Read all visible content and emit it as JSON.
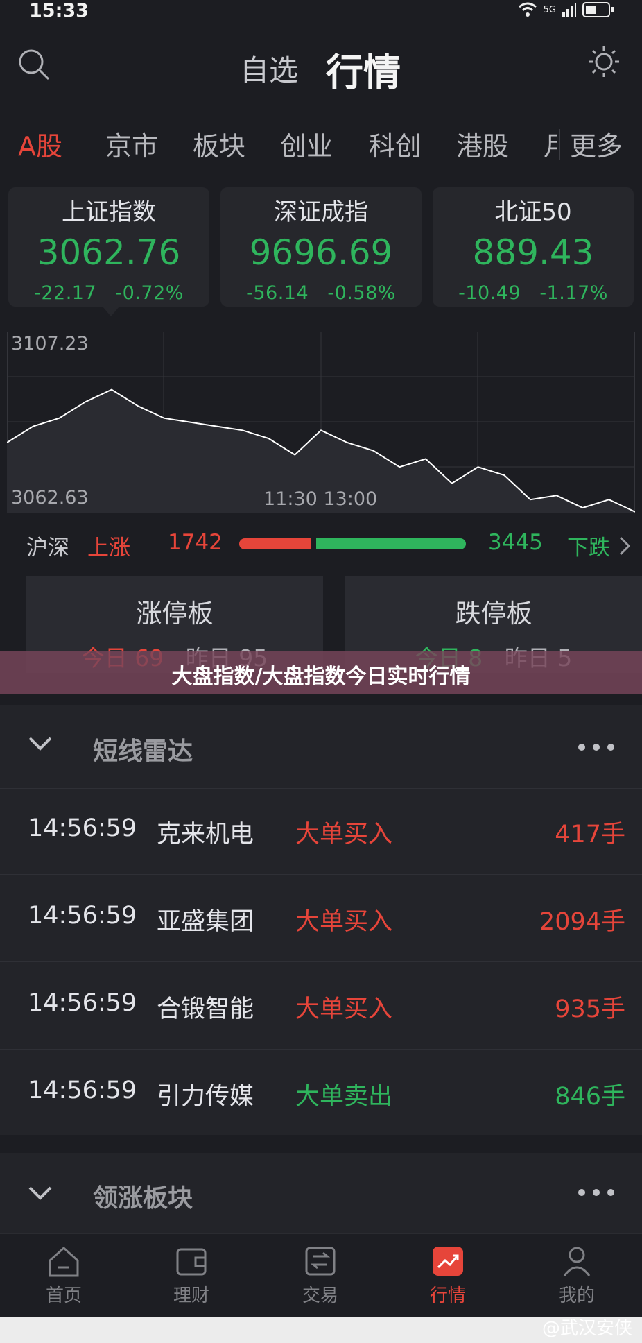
{
  "status": {
    "time": "15:33",
    "network": "5G"
  },
  "header": {
    "tab_watchlist": "自选",
    "tab_market": "行情"
  },
  "market_tabs": [
    {
      "label": "A股",
      "active": true
    },
    {
      "label": "京市"
    },
    {
      "label": "板块"
    },
    {
      "label": "创业"
    },
    {
      "label": "科创"
    },
    {
      "label": "港股"
    },
    {
      "label": "月"
    },
    {
      "label": "更多"
    }
  ],
  "indices": [
    {
      "name": "上证指数",
      "value": "3062.76",
      "change": "-22.17",
      "pct": "-0.72%"
    },
    {
      "name": "深证成指",
      "value": "9696.69",
      "change": "-56.14",
      "pct": "-0.58%"
    },
    {
      "name": "北证50",
      "value": "889.43",
      "change": "-10.49",
      "pct": "-1.17%"
    }
  ],
  "chart": {
    "high_label": "3107.23",
    "low_label": "3062.63",
    "time_label": "11:30 13:00",
    "line_color": "#ffffff"
  },
  "chart_data": {
    "type": "line",
    "x": [
      0,
      10,
      20,
      30,
      40,
      50,
      60,
      70,
      80,
      90,
      100,
      110,
      120,
      130,
      140,
      150,
      160,
      170,
      180,
      190,
      200,
      210,
      220,
      230,
      240
    ],
    "values": [
      3080,
      3084,
      3086,
      3090,
      3093,
      3089,
      3086,
      3085,
      3084,
      3083,
      3081,
      3077,
      3083,
      3080,
      3078,
      3074,
      3076,
      3070,
      3074,
      3072,
      3066,
      3067,
      3064,
      3066,
      3063
    ],
    "title": "",
    "ylim": [
      3062.63,
      3107.23
    ],
    "xlabel": "",
    "ylabel": ""
  },
  "advdec": {
    "label": "沪深",
    "up_label": "上涨",
    "up_count": "1742",
    "down_count": "3445",
    "down_label": "下跌",
    "up_ratio": 0.336
  },
  "limit_boards": [
    {
      "title": "涨停板",
      "today": "今日 69",
      "yesterday": "昨日 95"
    },
    {
      "title": "跌停板",
      "today": "今日 8",
      "yesterday": "昨日 5"
    }
  ],
  "banner": {
    "text": "大盘指数/大盘指数今日实时行情"
  },
  "radar": {
    "title": "短线雷达",
    "rows": [
      {
        "time": "14:56:59",
        "name": "克来机电",
        "type": "大单买入",
        "volume": "417手",
        "dir": "buy"
      },
      {
        "time": "14:56:59",
        "name": "亚盛集团",
        "type": "大单买入",
        "volume": "2094手",
        "dir": "buy"
      },
      {
        "time": "14:56:59",
        "name": "合锻智能",
        "type": "大单买入",
        "volume": "935手",
        "dir": "buy"
      },
      {
        "time": "14:56:59",
        "name": "引力传媒",
        "type": "大单卖出",
        "volume": "846手",
        "dir": "sell"
      }
    ]
  },
  "sector": {
    "title": "领涨板块"
  },
  "nav": [
    {
      "label": "首页",
      "icon": "home-icon"
    },
    {
      "label": "理财",
      "icon": "wallet-icon"
    },
    {
      "label": "交易",
      "icon": "trade-icon"
    },
    {
      "label": "行情",
      "icon": "chart-icon",
      "active": true
    },
    {
      "label": "我的",
      "icon": "user-icon"
    }
  ],
  "watermark": "@武汉安侠",
  "colors": {
    "up": "#e6453a",
    "down": "#2fb55d",
    "bg": "#1c1d22"
  }
}
